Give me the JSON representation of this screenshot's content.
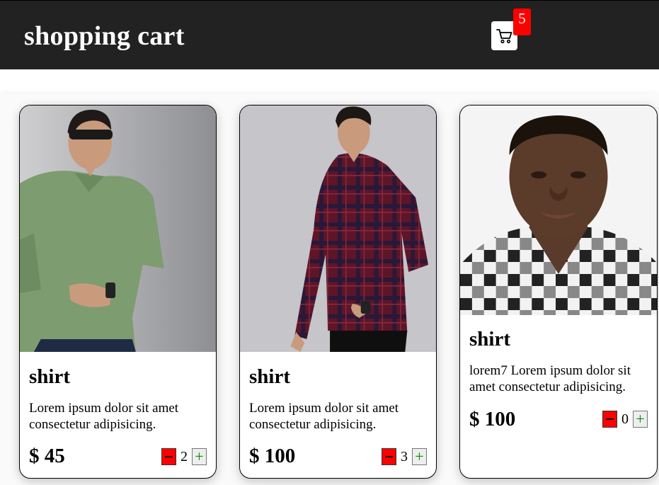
{
  "header": {
    "title": "shopping cart",
    "cart_count": "5",
    "cart_icon": "shopping-cart-icon",
    "background": "#222222"
  },
  "products": [
    {
      "title": "shirt",
      "description": "Lorem ipsum dolor sit amet consectetur adipisicing.",
      "price": "$ 45",
      "quantity": "2",
      "image": "man-green-shirt-photo"
    },
    {
      "title": "shirt",
      "description": "Lorem ipsum dolor sit amet consectetur adipisicing.",
      "price": "$ 100",
      "quantity": "3",
      "image": "man-plaid-shirt-photo"
    },
    {
      "title": "shirt",
      "description": "lorem7 Lorem ipsum dolor sit amet consectetur adipisicing.",
      "price": "$ 100",
      "quantity": "0",
      "image": "man-checkered-shirt-portrait"
    }
  ],
  "controls": {
    "minus_icon": "minus-icon",
    "plus_icon": "plus-icon",
    "plus_label": "+",
    "minus_color": "#ff0000",
    "plus_color": "#0a8a0a"
  }
}
